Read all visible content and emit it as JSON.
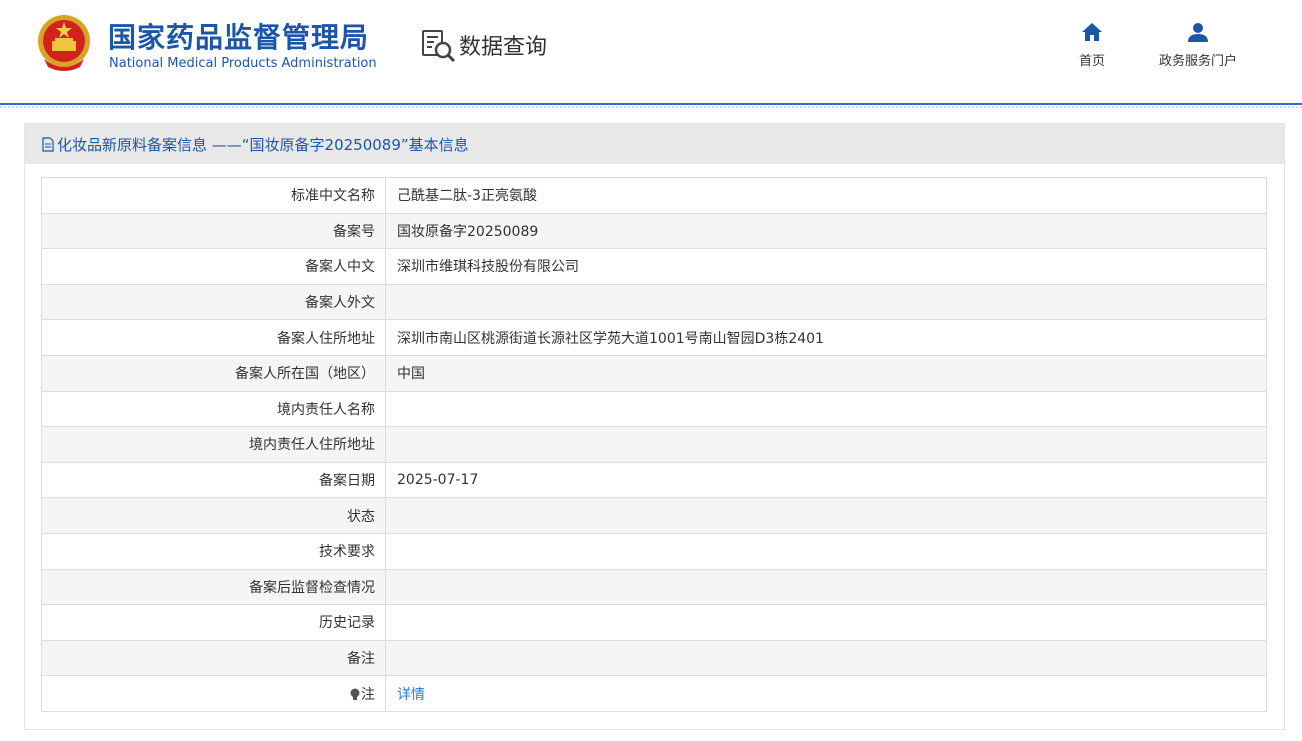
{
  "header": {
    "logo_cn": "国家药品监督管理局",
    "logo_en": "National Medical Products Administration",
    "query_label": "数据查询",
    "nav": [
      {
        "label": "首页",
        "icon": "home-icon"
      },
      {
        "label": "政务服务门户",
        "icon": "user-icon"
      }
    ]
  },
  "panel": {
    "title": "化妆品新原料备案信息 ——“国妆原备字20250089”基本信息",
    "rows": [
      {
        "label": "标准中文名称",
        "value": "己酰基二肽-3正亮氨酸"
      },
      {
        "label": "备案号",
        "value": "国妆原备字20250089"
      },
      {
        "label": "备案人中文",
        "value": "深圳市维琪科技股份有限公司"
      },
      {
        "label": "备案人外文",
        "value": ""
      },
      {
        "label": "备案人住所地址",
        "value": "深圳市南山区桃源街道长源社区学苑大道1001号南山智园D3栋2401"
      },
      {
        "label": "备案人所在国（地区）",
        "value": "中国"
      },
      {
        "label": "境内责任人名称",
        "value": ""
      },
      {
        "label": "境内责任人住所地址",
        "value": ""
      },
      {
        "label": "备案日期",
        "value": "2025-07-17"
      },
      {
        "label": "状态",
        "value": ""
      },
      {
        "label": "技术要求",
        "value": ""
      },
      {
        "label": "备案后监督检查情况",
        "value": ""
      },
      {
        "label": "历史记录",
        "value": ""
      },
      {
        "label": "备注",
        "value": ""
      }
    ],
    "note": {
      "label": "注",
      "link": "详情"
    }
  },
  "colors": {
    "brand": "#1c56a8",
    "link": "#2a7ad6",
    "header_rule": "#2a6fc7"
  }
}
